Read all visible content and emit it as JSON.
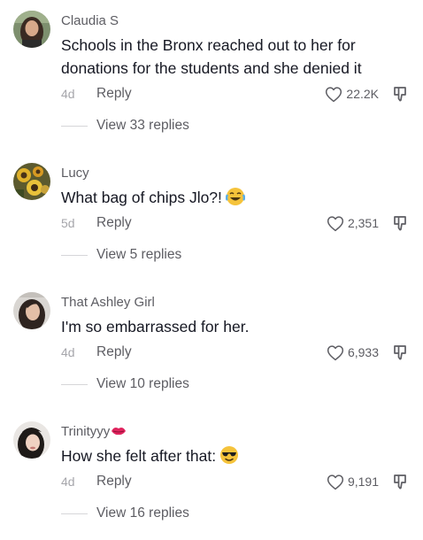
{
  "comments": [
    {
      "username": "Claudia S",
      "text": "Schools in the Bronx reached out to her for donations for the students and she denied it",
      "time": "4d",
      "reply_label": "Reply",
      "likes": "22.2K",
      "view_replies": "View 33 replies",
      "avatar": "avatar-woman-long-dark-hair"
    },
    {
      "username": "Lucy",
      "text": "What bag of chips Jlo?!",
      "emoji": "face-with-tears-of-joy-emoji",
      "time": "5d",
      "reply_label": "Reply",
      "likes": "2,351",
      "view_replies": "View 5 replies",
      "avatar": "avatar-sunflowers"
    },
    {
      "username": "That Ashley Girl",
      "text": "I'm so embarrassed for her.",
      "time": "4d",
      "reply_label": "Reply",
      "likes": "6,933",
      "view_replies": "View 10 replies",
      "avatar": "avatar-woman-selfie"
    },
    {
      "username": "Trinityyy",
      "username_emoji": "kiss-mark-emoji",
      "text": "How she felt after that:",
      "emoji": "smiling-face-with-sunglasses-emoji",
      "time": "4d",
      "reply_label": "Reply",
      "likes": "9,191",
      "view_replies": "View 16 replies",
      "avatar": "avatar-woman-dark-hair"
    }
  ],
  "colors": {
    "text_primary": "#161823",
    "text_secondary": "#5d5d63",
    "text_muted": "#a6a6ab",
    "divider": "#d6d6d9",
    "emoji_yellow": "#f5c33b",
    "kiss_red": "#e0245e"
  }
}
